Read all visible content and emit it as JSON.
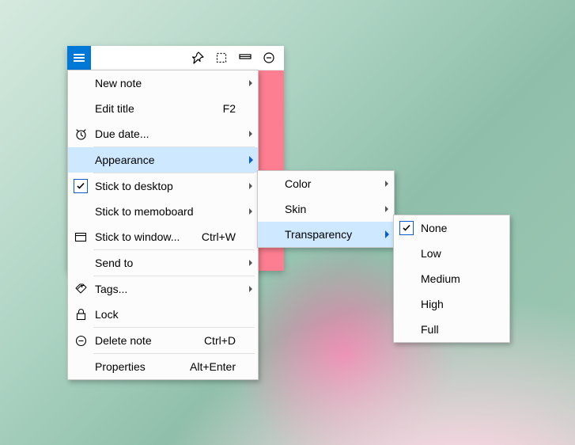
{
  "note": {},
  "toolbar": {},
  "main_menu": {
    "new_note": "New note",
    "edit_title": "Edit title",
    "edit_title_shortcut": "F2",
    "due_date": "Due date...",
    "appearance": "Appearance",
    "stick_to_desktop": "Stick to desktop",
    "stick_to_memoboard": "Stick to memoboard",
    "stick_to_window": "Stick to window...",
    "stick_to_window_shortcut": "Ctrl+W",
    "send_to": "Send to",
    "tags": "Tags...",
    "lock": "Lock",
    "delete_note": "Delete note",
    "delete_note_shortcut": "Ctrl+D",
    "properties": "Properties",
    "properties_shortcut": "Alt+Enter"
  },
  "appearance_menu": {
    "color": "Color",
    "skin": "Skin",
    "transparency": "Transparency"
  },
  "transparency_menu": {
    "none": "None",
    "low": "Low",
    "medium": "Medium",
    "high": "High",
    "full": "Full",
    "selected": "none"
  }
}
